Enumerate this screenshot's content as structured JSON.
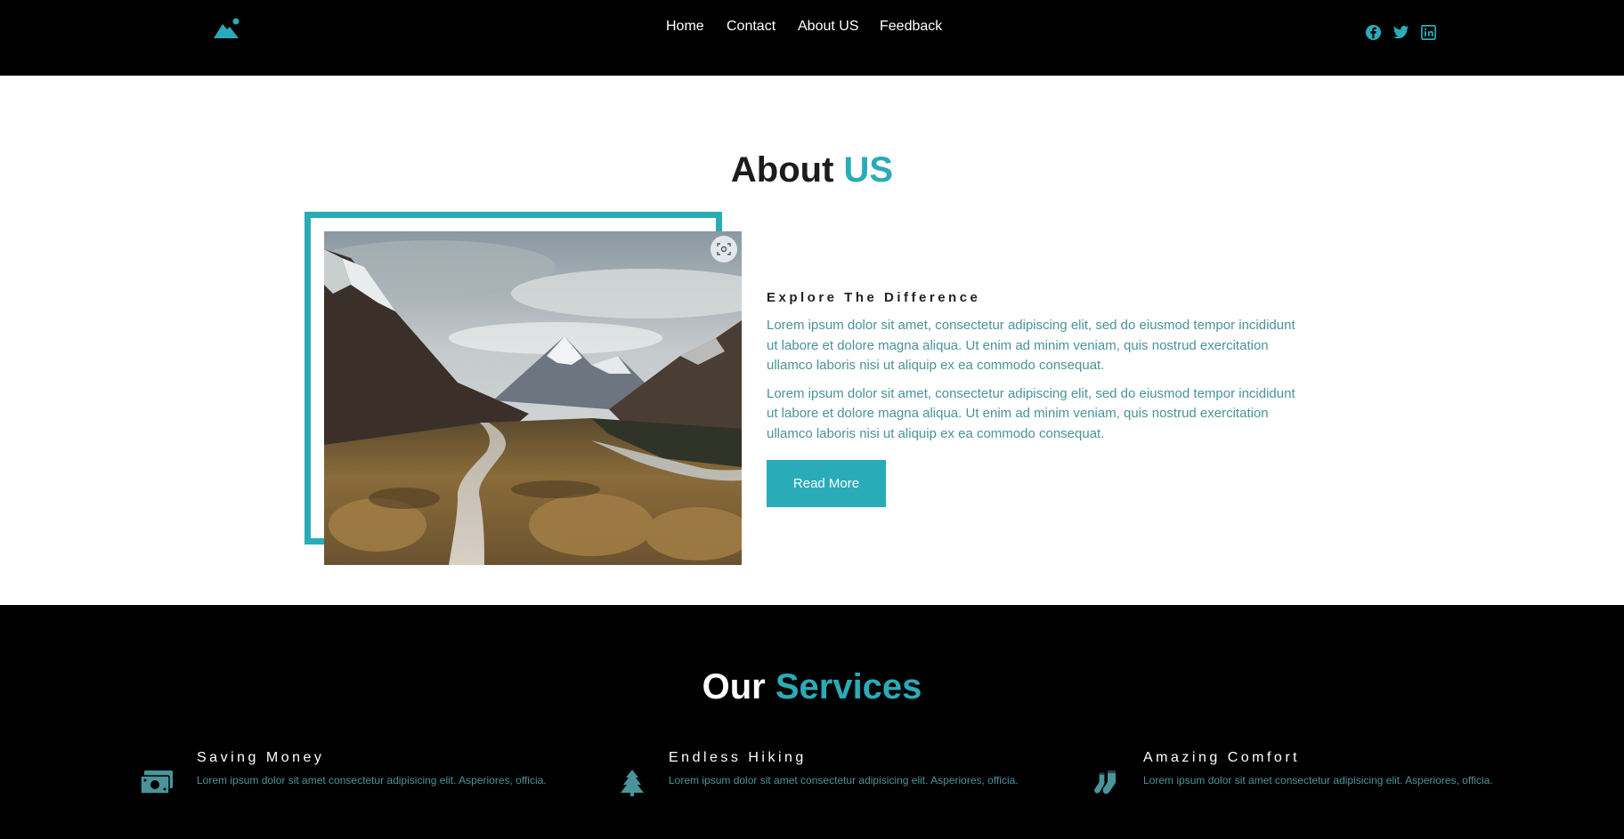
{
  "nav": {
    "items": [
      {
        "label": "Home"
      },
      {
        "label": "Contact"
      },
      {
        "label": "About US"
      },
      {
        "label": "Feedback"
      }
    ]
  },
  "socials": [
    "facebook-icon",
    "twitter-icon",
    "linkedin-icon"
  ],
  "about": {
    "title_main": "About",
    "title_accent": "US",
    "subtitle": "Explore The Difference",
    "paragraphs": [
      "Lorem ipsum dolor sit amet, consectetur adipiscing elit, sed do eiusmod tempor incididunt ut labore et dolore magna aliqua. Ut enim ad minim veniam, quis nostrud exercitation ullamco laboris nisi ut aliquip ex ea commodo consequat.",
      "Lorem ipsum dolor sit amet, consectetur adipiscing elit, sed do eiusmod tempor incididunt ut labore et dolore magna aliqua. Ut enim ad minim veniam, quis nostrud exercitation ullamco laboris nisi ut aliquip ex ea commodo consequat."
    ],
    "button": "Read More"
  },
  "services": {
    "title_main": "Our",
    "title_accent": "Services",
    "items": [
      {
        "icon": "money-icon",
        "title": "Saving Money",
        "desc": "Lorem ipsum dolor sit amet consectetur adipisicing elit. Asperiores, officia."
      },
      {
        "icon": "tree-icon",
        "title": "Endless Hiking",
        "desc": "Lorem ipsum dolor sit amet consectetur adipisicing elit. Asperiores, officia."
      },
      {
        "icon": "socks-icon",
        "title": "Amazing Comfort",
        "desc": "Lorem ipsum dolor sit amet consectetur adipisicing elit. Asperiores, officia."
      }
    ]
  },
  "colors": {
    "accent": "#2aabb8",
    "text_muted": "#4a939a",
    "dark": "#000000"
  }
}
